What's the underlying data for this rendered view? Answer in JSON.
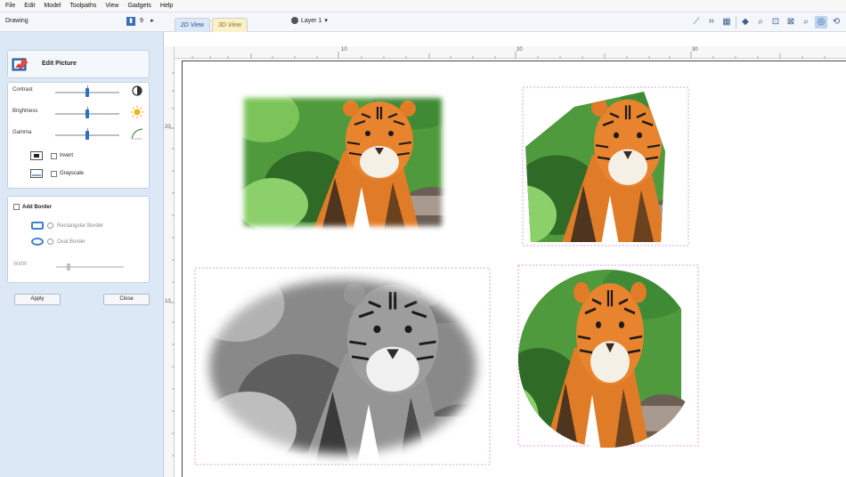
{
  "menu": [
    "File",
    "Edit",
    "Model",
    "Toolpaths",
    "View",
    "Gadgets",
    "Help"
  ],
  "panel": {
    "title": "Drawing",
    "pin_label": "9"
  },
  "tabs": [
    {
      "label": "2D View",
      "active": true
    },
    {
      "label": "3D View",
      "active": false
    }
  ],
  "layer": {
    "label": "Layer 1"
  },
  "edit_picture": {
    "title": "Edit Picture",
    "sliders": [
      {
        "label": "Contrast",
        "value": 0.5
      },
      {
        "label": "Brightness",
        "value": 0.5
      },
      {
        "label": "Gamma",
        "value": 0.5
      }
    ],
    "invert_label": "Invert",
    "grayscale_label": "Grayscale"
  },
  "border": {
    "title": "Add Border",
    "rect_label": "Rectangular Border",
    "oval_label": "Oval Border",
    "width_label": "Width"
  },
  "buttons": {
    "apply": "Apply",
    "close": "Close"
  },
  "ruler": {
    "top": [
      "10",
      "20",
      "30"
    ],
    "left": [
      "20",
      "10"
    ]
  },
  "colors": {
    "accent": "#2f6fbe",
    "panel_bg": "#dce8f5",
    "selection": "#e19fe0",
    "tiger_orange": "#e07b27",
    "foliage": "#4f9a3c"
  }
}
